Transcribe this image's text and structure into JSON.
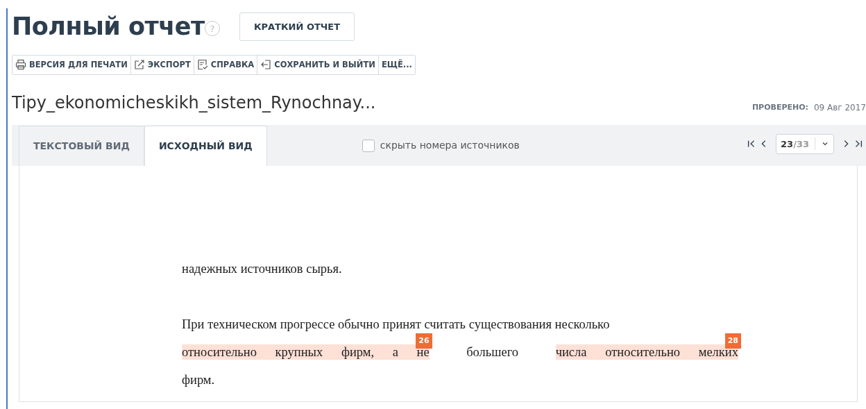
{
  "header": {
    "title": "Полный отчет",
    "help_mark": "?",
    "short_report_button": "КРАТКИЙ ОТЧЕТ"
  },
  "toolbar": [
    {
      "kind": "print",
      "label": "ВЕРСИЯ ДЛЯ ПЕЧАТИ"
    },
    {
      "kind": "export",
      "label": "ЭКСПОРТ"
    },
    {
      "kind": "help",
      "label": "СПРАВКА"
    },
    {
      "kind": "exit",
      "label": "СОХРАНИТЬ И ВЫЙТИ"
    },
    {
      "kind": "more",
      "label": "ЕЩЁ..."
    }
  ],
  "document": {
    "file_name": "Tipy_ekonomicheskikh_sistem_Rynochnay...",
    "checked_label": "ПРОВЕРЕНО:",
    "checked_date": "09 Авг 2017"
  },
  "tabs": [
    {
      "label": "ТЕКСТОВЫЙ ВИД",
      "selected": false
    },
    {
      "label": "ИСХОДНЫЙ ВИД",
      "selected": true
    }
  ],
  "hide_sources": {
    "label": "скрыть номера источников",
    "checked": false
  },
  "pager": {
    "current": "23",
    "total": "/33"
  },
  "paragraphs": [
    {
      "lines": [
        [
          {
            "text": "надежных источников сырья.",
            "highlighted": false
          }
        ]
      ]
    },
    {
      "lines": [
        [
          {
            "text": "При техническом прогрессе обычно принят считать существования несколько",
            "highlighted": false
          }
        ],
        [
          {
            "text": "относительно крупных фирм, а не",
            "highlighted": true,
            "source": "26"
          },
          {
            "text": "большего",
            "highlighted": false
          },
          {
            "text": "числа относительно мелких",
            "highlighted": true,
            "source": "28"
          }
        ],
        [
          {
            "text": "фирм.",
            "highlighted": false
          }
        ]
      ]
    }
  ]
}
